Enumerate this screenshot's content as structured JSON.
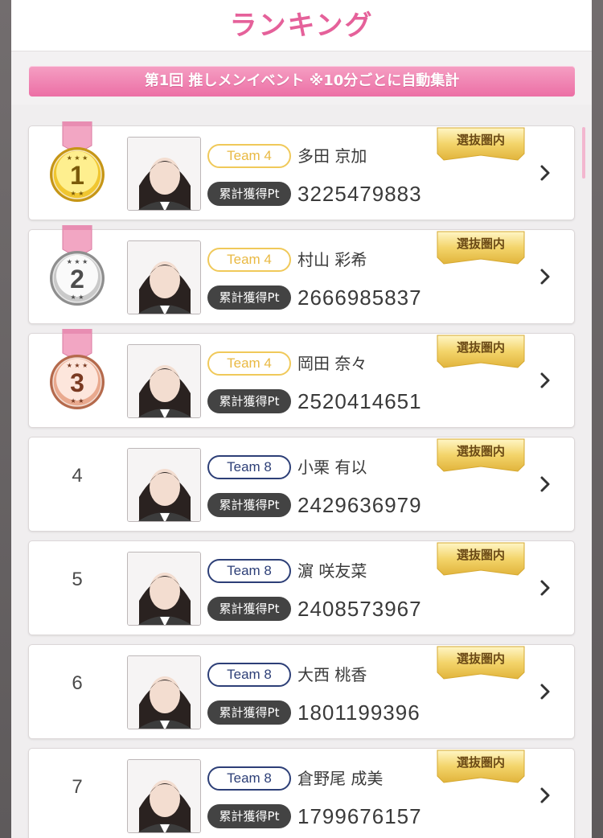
{
  "header": {
    "title": "ランキング"
  },
  "banner": {
    "text": "第1回 推しメンイベント ※10分ごとに自動集計"
  },
  "labels": {
    "pt_label": "累計獲得Pt",
    "senbatsu": "選抜圏内"
  },
  "colors": {
    "accent_pink": "#e5619a",
    "team4": "#f0c95a",
    "team8": "#2d3f77"
  },
  "rankings": [
    {
      "rank": "1",
      "medal": "gold",
      "team": "Team 4",
      "team_style": "gold",
      "name": "多田 京加",
      "points": "3225479883"
    },
    {
      "rank": "2",
      "medal": "silver",
      "team": "Team 4",
      "team_style": "gold",
      "name": "村山 彩希",
      "points": "2666985837"
    },
    {
      "rank": "3",
      "medal": "bronze",
      "team": "Team 4",
      "team_style": "gold",
      "name": "岡田 奈々",
      "points": "2520414651"
    },
    {
      "rank": "4",
      "medal": "",
      "team": "Team 8",
      "team_style": "navy",
      "name": "小栗 有以",
      "points": "2429636979"
    },
    {
      "rank": "5",
      "medal": "",
      "team": "Team 8",
      "team_style": "navy",
      "name": "濵 咲友菜",
      "points": "2408573967"
    },
    {
      "rank": "6",
      "medal": "",
      "team": "Team 8",
      "team_style": "navy",
      "name": "大西 桃香",
      "points": "1801199396"
    },
    {
      "rank": "7",
      "medal": "",
      "team": "Team 8",
      "team_style": "navy",
      "name": "倉野尾 成美",
      "points": "1799676157"
    }
  ]
}
